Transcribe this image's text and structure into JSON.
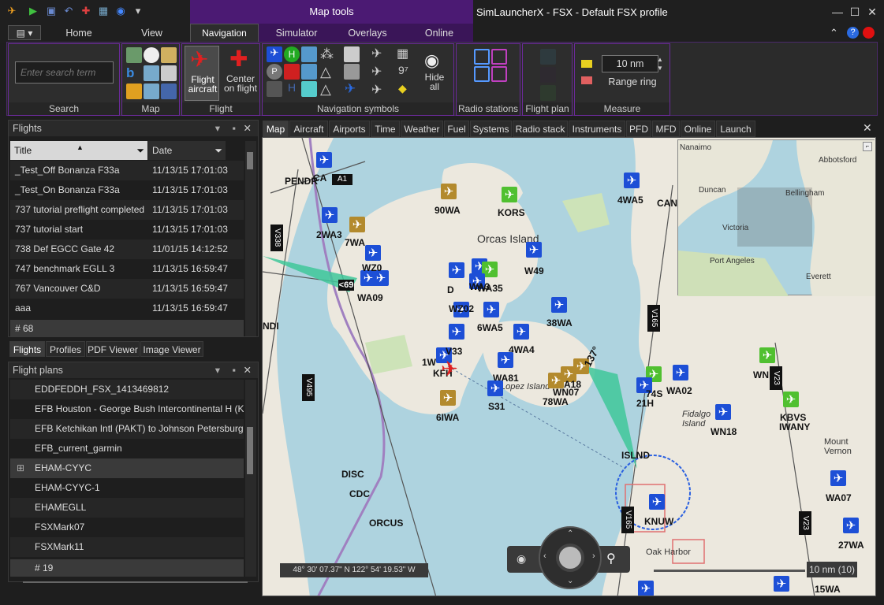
{
  "window": {
    "title": "SimLauncherX - FSX - Default FSX profile",
    "map_tools_label": "Map tools"
  },
  "ribbon_tabs": [
    "Home",
    "View",
    "Navigation",
    "Simulator",
    "Overlays",
    "Online"
  ],
  "search": {
    "placeholder": "Enter search term",
    "group_label": "Search"
  },
  "groups": {
    "map": "Map",
    "flight": "Flight",
    "nav_symbols": "Navigation symbols",
    "radio": "Radio stations",
    "flight_plan": "Flight plan",
    "measure": "Measure"
  },
  "flight_btns": {
    "flight_aircraft": "Flight aircraft",
    "center_on_flight": "Center on flight"
  },
  "hide_all": "Hide all",
  "measure": {
    "value": "10 nm",
    "range_ring": "Range ring"
  },
  "flights_panel": {
    "title": "Flights",
    "col_title": "Title",
    "col_date": "Date",
    "rows": [
      {
        "title": "_Test_Off Bonanza F33a",
        "date": "11/13/15 17:01:03"
      },
      {
        "title": "_Test_On Bonanza F33a",
        "date": "11/13/15 17:01:03"
      },
      {
        "title": "737 tutorial preflight completed",
        "date": "11/13/15 17:01:03"
      },
      {
        "title": "737 tutorial start",
        "date": "11/13/15 17:01:03"
      },
      {
        "title": "738 Def EGCC Gate 42",
        "date": "11/01/15 14:12:52"
      },
      {
        "title": "747 benchmark EGLL 3",
        "date": "11/13/15 16:59:47"
      },
      {
        "title": "767 Vancouver C&D",
        "date": "11/13/15 16:59:47"
      },
      {
        "title": "aaa",
        "date": "11/13/15 16:59:47"
      }
    ],
    "count": "# 68"
  },
  "bottom_tabs": [
    "Flights",
    "Profiles",
    "PDF Viewer",
    "Image Viewer"
  ],
  "flightplans_panel": {
    "title": "Flight plans",
    "rows": [
      "EDDFEDDH_FSX_1413469812",
      "EFB Houston - George Bush Intercontinental H (KI/",
      "EFB Ketchikan Intl (PAKT) to Johnson Petersburg (F",
      "EFB_current_garmin",
      "EHAM-CYYC",
      "EHAM-CYYC-1",
      "EHAMEGLL",
      "FSXMark07",
      "FSXMark11"
    ],
    "count": "# 19"
  },
  "map_tabs": [
    "Map",
    "Aircraft",
    "Airports",
    "Time",
    "Weather",
    "Fuel",
    "Systems",
    "Radio stack",
    "Instruments",
    "PFD",
    "MFD",
    "Online",
    "Launch"
  ],
  "map": {
    "coords": "48° 30' 07.37\" N 122° 54' 19.53\" W",
    "scale": "10 nm (10)",
    "labels": {
      "pendr": "PENDR",
      "ca": "CA",
      "a1": "A1",
      "v338": "V338",
      "wa2": "2WA3",
      "7wa": "7WA",
      "90wa": "90WA",
      "kors": "KORS",
      "4wa5": "4WA5",
      "cant": "CANT",
      "wz0": "WZ0",
      "wa09": "WA09",
      "orcas": "Orcas Island",
      "da": "D",
      "wa35": "WA35",
      "wa3": "WA3",
      "w49": "W49",
      "wz02": "WZ02",
      "6wa5": "6WA5",
      "38wa": "38WA",
      "ndi": "NDI",
      "v33": "V33",
      "1w": "1W",
      "kfh": "KFH",
      "4wa4": "4WA4",
      "v165": "V165",
      "wa81": "WA81",
      "lopez": "Lopez Island",
      "wn07": "WN07",
      "78wa": "78WA",
      "a18": "A18",
      "s31": "S31",
      "6iwa": "6IWA",
      "74s": "74S",
      "21h": "21H",
      "wa02": "WA02",
      "wn18": "WN18",
      "fidalgo": "Fidalgo Island",
      "island": "ISLND",
      "wn": "WN",
      "kbvs": "KBVS",
      "iwany": "IWANY",
      "v495": "V495",
      "cdc": "CDC",
      "disc": "DISC",
      "orcus": "ORCUS",
      "knuw": "KNUW",
      "oak": "Oak Harbor",
      "v23": "V23",
      "wa07": "WA07",
      "27wa": "27WA",
      "15wa": "15WA",
      "mt": "Mount Vernon",
      "hdg": "137°",
      "dist": "<69"
    },
    "inset": {
      "nanaimo": "Nanaimo",
      "abbotsford": "Abbotsford",
      "duncan": "Duncan",
      "bellingham": "Bellingham",
      "victoria": "Victoria",
      "port_angeles": "Port Angeles",
      "everett": "Everett"
    }
  },
  "colors": {
    "accent_purple": "#6b2a9a",
    "airport_blue": "#1d4fd6",
    "airport_green": "#50c030",
    "airport_gold": "#b38a2d",
    "aircraft_red": "#e02020"
  }
}
